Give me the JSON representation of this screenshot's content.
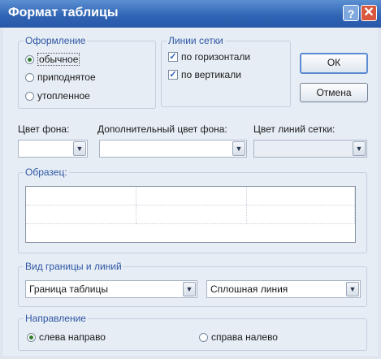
{
  "window": {
    "title": "Формат таблицы",
    "help_symbol": "?",
    "close_symbol": "✕"
  },
  "appearance": {
    "legend": "Оформление",
    "options": [
      {
        "label": "обычное",
        "selected": true
      },
      {
        "label": "приподнятое",
        "selected": false
      },
      {
        "label": "утопленное",
        "selected": false
      }
    ]
  },
  "gridlines": {
    "legend": "Линии сетки",
    "options": [
      {
        "label": "по горизонтали",
        "checked": true
      },
      {
        "label": "по вертикали",
        "checked": true
      }
    ]
  },
  "buttons": {
    "ok": "ОК",
    "cancel": "Отмена"
  },
  "colors": {
    "background_label": "Цвет фона:",
    "alt_background_label": "Дополнительный цвет фона:",
    "gridline_color_label": "Цвет линий сетки:"
  },
  "sample": {
    "legend": "Образец:"
  },
  "border": {
    "legend": "Вид границы и линий",
    "border_select": "Граница таблицы",
    "line_select": "Сплошная линия"
  },
  "direction": {
    "legend": "Направление",
    "options": [
      {
        "label": "слева направо",
        "selected": true
      },
      {
        "label": "справа налево",
        "selected": false
      }
    ]
  },
  "icons": {
    "dropdown": "chevron-down-icon"
  },
  "accent_colors": {
    "title_bar": "#2f63b4",
    "legend_text": "#2d56a3",
    "close": "#d9583e"
  }
}
